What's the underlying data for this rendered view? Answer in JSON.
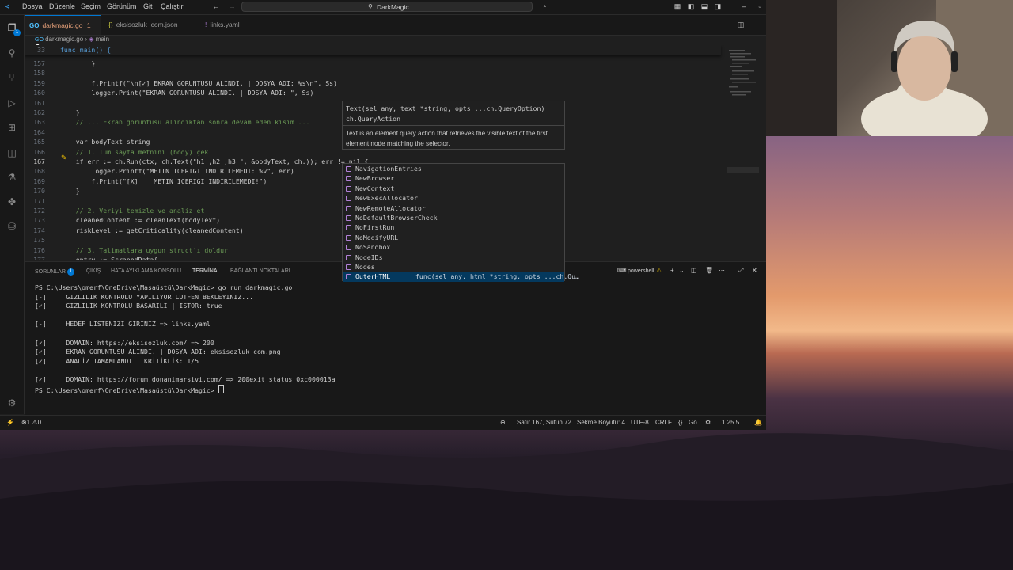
{
  "window": {
    "menu": [
      "Dosya",
      "Düzenle",
      "Seçim",
      "Görünüm",
      "Git",
      "Çalıştır"
    ],
    "search_text": "DarkMagic"
  },
  "tabs": [
    {
      "label": "darkmagic.go",
      "suffix": "1",
      "icon": "go-icon"
    },
    {
      "label": "eksisozluk_com.json",
      "icon": "json-icon"
    },
    {
      "label": "links.yaml",
      "icon": "yaml-icon"
    }
  ],
  "breadcrumb": {
    "file": "darkmagic.go",
    "symbol": "main"
  },
  "activity_badge": "1",
  "sticky": {
    "num": "33",
    "text": "func main() {"
  },
  "code_lines": [
    {
      "num": "157",
      "text": "        }"
    },
    {
      "num": "158",
      "text": ""
    },
    {
      "num": "159",
      "text": "        f.Printf(\"\\n[✓] EKRAN GORUNTUSU ALINDI. | DOSYA ADI: %s\\n\", Ss)"
    },
    {
      "num": "160",
      "text": "        logger.Print(\"EKRAN GORUNTUSU ALINDI. | DOSYA ADI: \", Ss)"
    },
    {
      "num": "161",
      "text": ""
    },
    {
      "num": "162",
      "text": "    }"
    },
    {
      "num": "163",
      "text": "    // ... Ekran görüntüsü alındıktan sonra devam eden kısım ..."
    },
    {
      "num": "164",
      "text": ""
    },
    {
      "num": "165",
      "text": "    var bodyText string"
    },
    {
      "num": "166",
      "text": "    // 1. Tüm sayfa metnini (body) çek"
    },
    {
      "num": "167",
      "text": "    if err := ch.Run(ctx, ch.Text(\"h1 ,h2 ,h3 \", &bodyText, ch.)); err != nil {"
    },
    {
      "num": "168",
      "text": "        logger.Printf(\"METIN ICERIGI INDIRILEMEDI: %v\", err)"
    },
    {
      "num": "169",
      "text": "        f.Print(\"[X]    METIN ICERIGI INDIRILEMEDI!\")"
    },
    {
      "num": "170",
      "text": "    }"
    },
    {
      "num": "171",
      "text": ""
    },
    {
      "num": "172",
      "text": "    // 2. Veriyi temizle ve analiz et"
    },
    {
      "num": "173",
      "text": "    cleanedContent := cleanText(bodyText)"
    },
    {
      "num": "174",
      "text": "    riskLevel := getCriticality(cleanedContent)"
    },
    {
      "num": "175",
      "text": ""
    },
    {
      "num": "176",
      "text": "    // 3. Talimatlara uygun struct'ı doldur"
    },
    {
      "num": "177",
      "text": "    entry := ScrapedData{"
    }
  ],
  "hover": {
    "sig_line1": "Text(sel any, text *string, opts ...ch.QueryOption)",
    "sig_line2": "ch.QueryAction",
    "doc": "Text is an element query action that retrieves the visible text of the first element node matching the selector."
  },
  "suggestions": [
    {
      "label": "NavigationEntries"
    },
    {
      "label": "NewBrowser"
    },
    {
      "label": "NewContext"
    },
    {
      "label": "NewExecAllocator"
    },
    {
      "label": "NewRemoteAllocator"
    },
    {
      "label": "NoDefaultBrowserCheck"
    },
    {
      "label": "NoFirstRun"
    },
    {
      "label": "NoModifyURL"
    },
    {
      "label": "NoSandbox"
    },
    {
      "label": "NodeIDs"
    },
    {
      "label": "Nodes"
    },
    {
      "label": "OuterHTML",
      "detail": "func(sel any, html *string, opts ...ch.Qu…",
      "selected": true
    }
  ],
  "panel": {
    "tabs": [
      "SORUNLAR",
      "ÇIKIŞ",
      "HATA AYIKLAMA KONSOLU",
      "TERMİNAL",
      "BAĞLANTI NOKTALARI"
    ],
    "problems_count": "1",
    "active_tab": "TERMİNAL",
    "shell": "powershell"
  },
  "terminal_lines": [
    "PS C:\\Users\\omerf\\OneDrive\\Masaüstü\\DarkMagic> go run darkmagic.go",
    "[-]     GIZLILIK KONTROLU YAPILIYOR LUTFEN BEKLEYINIZ...",
    "[✓]     GIZLILIK KONTROLU BASARILI | ISTOR: true",
    "",
    "[-]     HEDEF LISTENIZI GIRINIZ => links.yaml",
    "",
    "[✓]     DOMAIN: https://eksisozluk.com/ => 200",
    "[✓]     EKRAN GORUNTUSU ALINDI. | DOSYA ADI: eksisozluk_com.png",
    "[✓]     ANALİZ TAMAMLANDI | KRİTİKLİK: 1/5",
    "",
    "[✓]     DOMAIN: https://forum.donanimarsivi.com/ => 200exit status 0xc000013a",
    "PS C:\\Users\\omerf\\OneDrive\\Masaüstü\\DarkMagic> "
  ],
  "status": {
    "errors": "1",
    "warnings": "0",
    "position": "Satır 167, Sütun 72",
    "indent": "Sekme Boyutu: 4",
    "encoding": "UTF-8",
    "eol": "CRLF",
    "language": "Go",
    "version": "1.25.5"
  },
  "colors": {
    "accent": "#0078d4",
    "editor_bg": "#1f1f1f",
    "chrome_bg": "#181818"
  }
}
